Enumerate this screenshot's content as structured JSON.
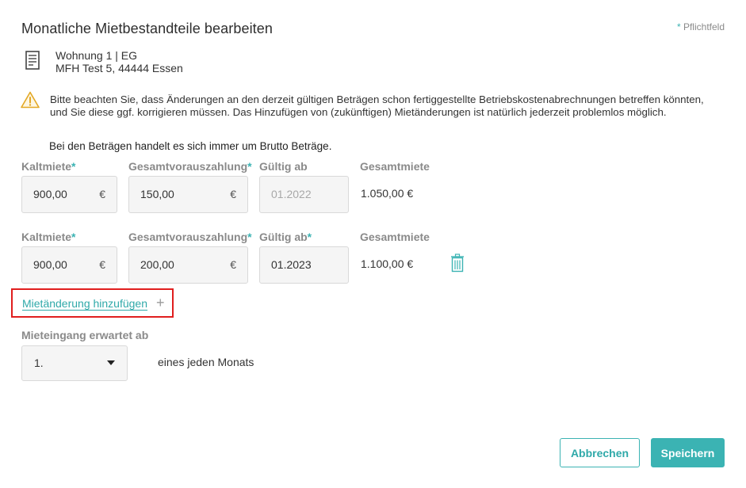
{
  "dialog": {
    "title": "Monatliche Mietbestandteile bearbeiten",
    "required_star": "*",
    "required_label": "Pflichtfeld"
  },
  "property": {
    "unit": "Wohnung 1 | EG",
    "address": "MFH Test 5, 44444 Essen"
  },
  "warning": {
    "text": "Bitte beachten Sie, dass Änderungen an den derzeit gültigen Beträgen schon fertiggestellte Betriebskostenabrechnungen betreffen könnten, und Sie diese ggf. korrigieren müssen. Das Hinzufügen von (zukünftigen) Mietänderungen ist natürlich jederzeit problemlos möglich."
  },
  "brutto_note": "Bei den Beträgen handelt es sich immer um Brutto Beträge.",
  "columns": {
    "kaltmiete": "Kaltmiete",
    "vorauszahlung": "Gesamtvorauszahlung",
    "gueltig": "Gültig ab",
    "gesamtmiete": "Gesamtmiete",
    "star": "*"
  },
  "currency": "€",
  "rows": [
    {
      "kaltmiete": "900,00",
      "vorauszahlung": "150,00",
      "gueltig": "01.2022",
      "gesamtmiete": "1.050,00 €"
    },
    {
      "kaltmiete": "900,00",
      "vorauszahlung": "200,00",
      "gueltig": "01.2023",
      "gesamtmiete": "1.100,00 €"
    }
  ],
  "add_change": {
    "label": "Mietänderung hinzufügen",
    "plus": "+"
  },
  "payment": {
    "label": "Mieteingang erwartet ab",
    "selected": "1.",
    "suffix": "eines jeden Monats"
  },
  "buttons": {
    "cancel": "Abbrechen",
    "save": "Speichern"
  },
  "colors": {
    "accent": "#3bb3b3",
    "highlight": "#e01e1e",
    "warning": "#e3a826"
  },
  "icons": {
    "property": "document-icon",
    "warning": "warning-icon",
    "delete": "trash-icon",
    "select": "caret-down-icon"
  }
}
